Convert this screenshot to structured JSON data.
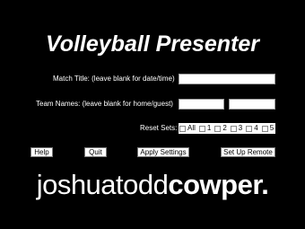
{
  "app": {
    "title": "Volleyball Presenter"
  },
  "form": {
    "match_title_label": "Match Title: (leave blank for date/time)",
    "match_title_value": "",
    "team_names_label": "Team Names: (leave blank for home/guest)",
    "home_team_value": "",
    "guest_team_value": "",
    "reset_sets_label": "Reset Sets:",
    "reset_sets_options": [
      "All",
      "1",
      "2",
      "3",
      "4",
      "5"
    ]
  },
  "buttons": {
    "help": "Help",
    "quit": "Quit",
    "apply": "Apply Settings",
    "remote": "Set Up Remote"
  },
  "branding": {
    "part1": "joshuatodd",
    "part2": "cowper."
  }
}
